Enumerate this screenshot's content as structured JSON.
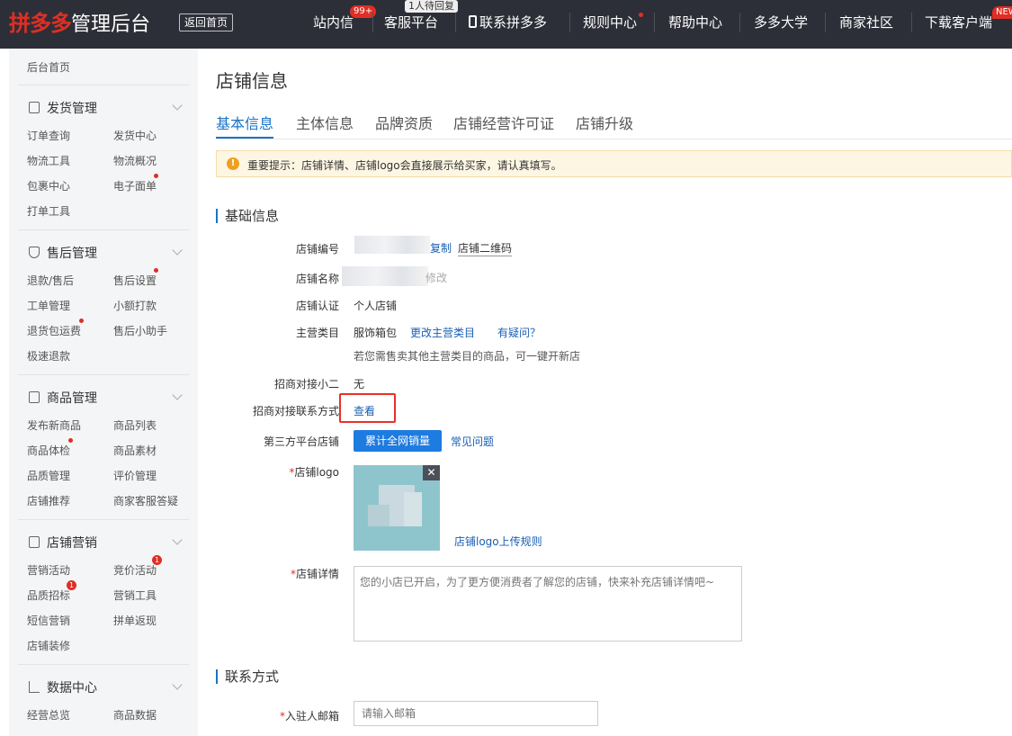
{
  "topbar": {
    "logo_brand": "拼多多",
    "logo_suffix": "管理后台",
    "back_home": "返回首页",
    "nav": {
      "station_msg": "站内信",
      "station_msg_badge": "99+",
      "customer_service": "客服平台",
      "customer_service_tip": "1人待回复",
      "contact": "联系拼多多",
      "rules": "规则中心",
      "help": "帮助中心",
      "university": "多多大学",
      "community": "商家社区",
      "download": "下载客户端",
      "download_badge": "NEW"
    }
  },
  "sidebar": {
    "home": "后台首页",
    "groups": [
      {
        "title": "发货管理",
        "items": [
          "订单查询",
          "发货中心",
          "物流工具",
          "物流概况",
          "包裹中心",
          "电子面单",
          "打单工具"
        ]
      },
      {
        "title": "售后管理",
        "items": [
          "退款/售后",
          "售后设置",
          "工单管理",
          "小额打款",
          "退货包运费",
          "售后小助手",
          "极速退款"
        ]
      },
      {
        "title": "商品管理",
        "items": [
          "发布新商品",
          "商品列表",
          "商品体检",
          "商品素材",
          "品质管理",
          "评价管理",
          "店铺推荐",
          "商家客服答疑"
        ]
      },
      {
        "title": "店铺营销",
        "items": [
          "营销活动",
          "竞价活动",
          "品质招标",
          "营销工具",
          "短信营销",
          "拼单返现",
          "店铺装修"
        ]
      },
      {
        "title": "数据中心",
        "items": [
          "经营总览",
          "商品数据"
        ]
      }
    ],
    "badges": {
      "bid": "1",
      "quality_bid": "1"
    }
  },
  "main": {
    "title": "店铺信息",
    "tabs": [
      "基本信息",
      "主体信息",
      "品牌资质",
      "店铺经营许可证",
      "店铺升级"
    ],
    "notice": "重要提示：店铺详情、店铺logo会直接展示给买家，请认真填写。",
    "basic_section": "基础信息",
    "fields": {
      "shop_id_label": "店铺编号",
      "copy": "复制",
      "qrcode": "店铺二维码",
      "shop_name_label": "店铺名称",
      "modify": "修改",
      "cert_label": "店铺认证",
      "cert_value": "个人店铺",
      "category_label": "主营类目",
      "category_value": "服饰箱包",
      "change_category": "更改主营类目",
      "question": "有疑问？",
      "category_hint": "若您需售卖其他主营类目的商品，可一键开新店",
      "bd_label": "招商对接小二",
      "bd_value": "无",
      "bd_contact_label": "招商对接联系方式",
      "view": "查看",
      "third_party_label": "第三方平台店铺",
      "total_sales": "累计全网销量",
      "faq": "常见问题",
      "logo_label": "店铺logo",
      "logo_rules": "店铺logo上传规则",
      "detail_label": "店铺详情",
      "detail_placeholder": "您的小店已开启，为了更方便消费者了解您的店铺，快来补充店铺详情吧~"
    },
    "contact_section": "联系方式",
    "email_label": "入驻人邮箱",
    "email_placeholder": "请输入邮箱"
  }
}
